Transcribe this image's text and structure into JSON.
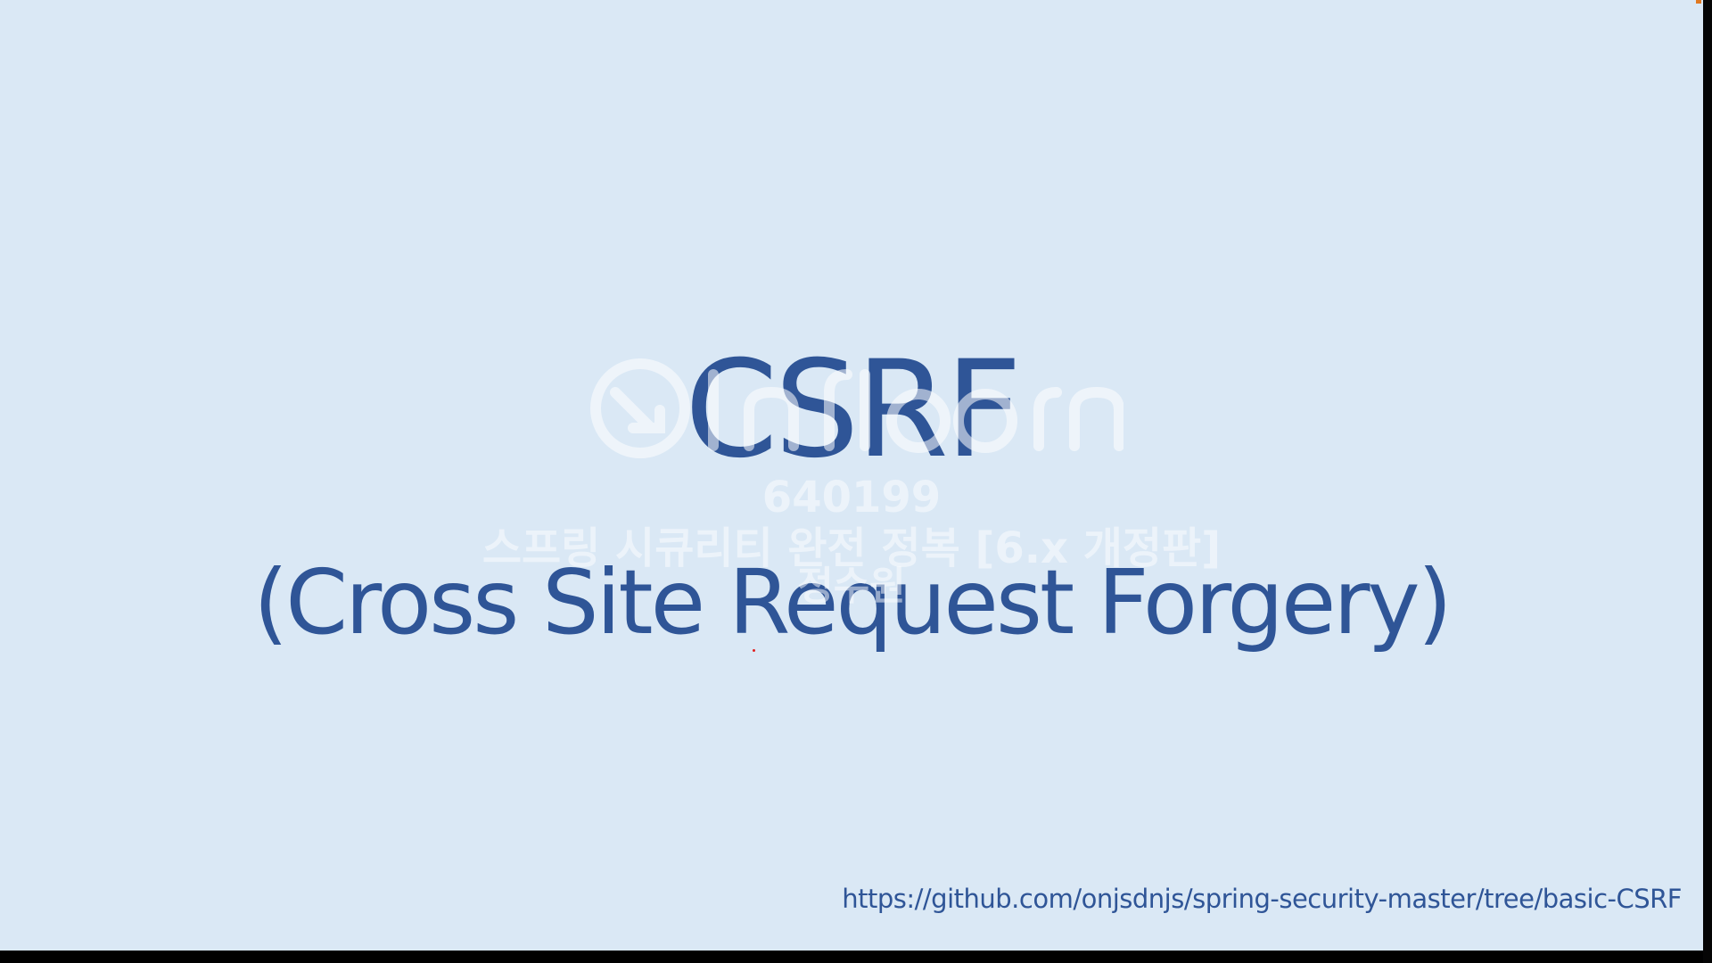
{
  "slide": {
    "title": "CSRF",
    "subtitle": "(Cross Site Request Forgery)",
    "url": "https://github.com/onjsdnjs/spring-security-master/tree/basic-CSRF"
  },
  "watermark": {
    "logo": "inflearn",
    "user_id": "640199",
    "course": "스프링 시큐리티 완전 정복 [6.x 개정판]",
    "name": "정수원"
  },
  "colors": {
    "background": "#dae8f5",
    "text": "#2f5597"
  }
}
